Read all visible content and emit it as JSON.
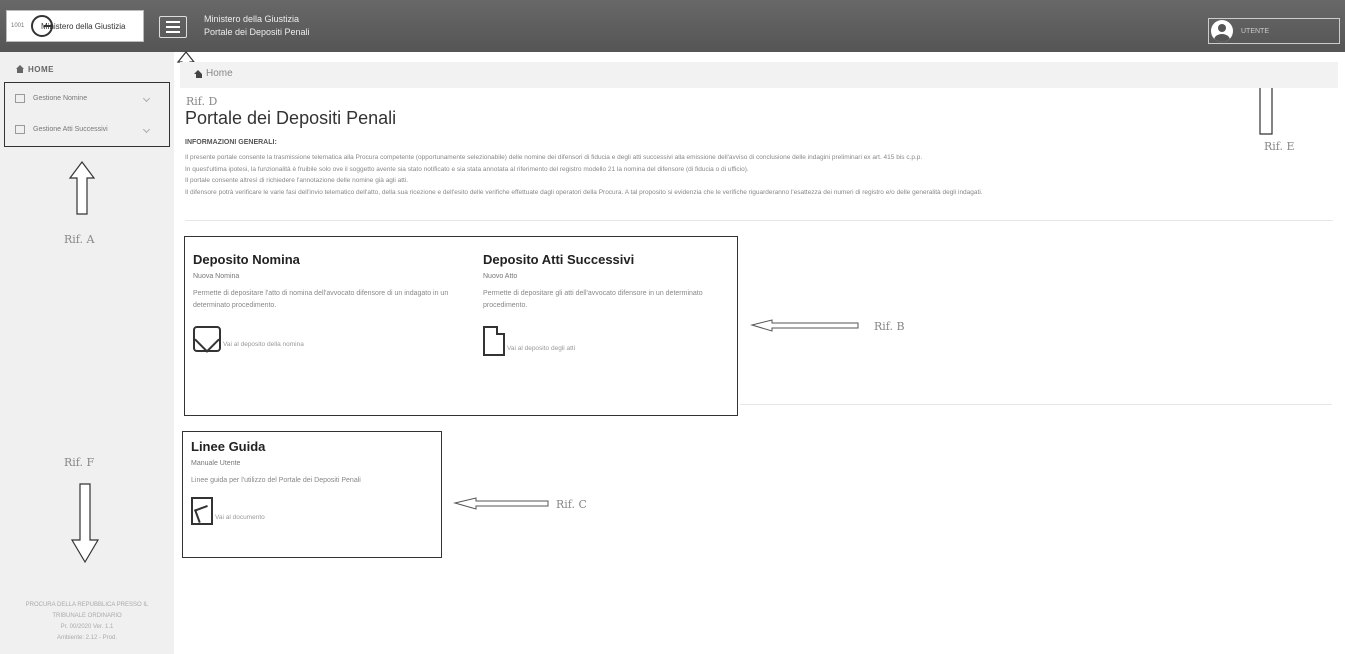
{
  "header": {
    "logo_text": "Ministero della Giustizia",
    "logo_small": "1001",
    "app_title_line1": "Ministero della Giustizia",
    "app_title_line2": "Portale dei Depositi Penali",
    "user_name": "UTENTE",
    "icons": [
      "logo-icon",
      "hamburger-icon",
      "user-icon"
    ]
  },
  "sidebar": {
    "home_label": "HOME",
    "items": [
      {
        "label": "Gestione Nomine"
      },
      {
        "label": "Gestione Atti Successivi"
      }
    ],
    "footer_lines": [
      "PROCURA DELLA REPUBBLICA PRESSO IL",
      "TRIBUNALE ORDINARIO",
      "Pr. 00/2020 Ver. 1.1",
      "Ambiente: 2.12 - Prod."
    ]
  },
  "annotations": {
    "ref_a": "Rif. A",
    "ref_b": "Rif. B",
    "ref_c": "Rif. C",
    "ref_d": "Rif. D",
    "ref_e": "Rif. E",
    "ref_f": "Rif. F"
  },
  "breadcrumb": {
    "home": "Home"
  },
  "main": {
    "title": "Portale dei Depositi Penali",
    "info_heading": "INFORMAZIONI GENERALI:",
    "info_lines": [
      "Il presente portale consente la trasmissione telematica alla Procura competente (opportunamente selezionabile) delle nomine dei difensori di fiducia e degli atti successivi alla emissione dell'avviso di conclusione delle indagini preliminari ex art. 415 bis c.p.p.",
      "In quest'ultima ipotesi, la funzionalità è fruibile solo ove il soggetto avente sia stato notificato e sia stata annotata al riferimento del registro modello 21 la nomina del difensore (di fiducia o di ufficio).",
      "Il portale consente altresì di richiedere l'annotazione delle nomine già agli atti.",
      "Il difensore potrà verificare le varie fasi dell'invio telematico dell'atto, della sua ricezione e dell'esito delle verifiche effettuate dagli operatori della Procura. A tal proposito si evidenzia che le verifiche riguarderanno l'esattezza dei numeri di registro e/o delle generalità degli indagati."
    ],
    "cards": [
      {
        "title": "Deposito Nomina",
        "subtitle": "Nuova Nomina",
        "description": "Permette di depositare l'atto di nomina dell'avvocato difensore di un indagato in un determinato procedimento.",
        "action": "Vai al deposito della nomina"
      },
      {
        "title": "Deposito Atti Successivi",
        "subtitle": "Nuovo Atto",
        "description": "Permette di depositare gli atti dell'avvocato difensore in un determinato procedimento.",
        "action": "Vai al deposito degli atti"
      },
      {
        "title": "Linee Guida",
        "subtitle": "Manuale Utente",
        "description": "Linee guida per l'utilizzo del Portale dei Depositi Penali",
        "action": "Vai al documento"
      }
    ]
  }
}
